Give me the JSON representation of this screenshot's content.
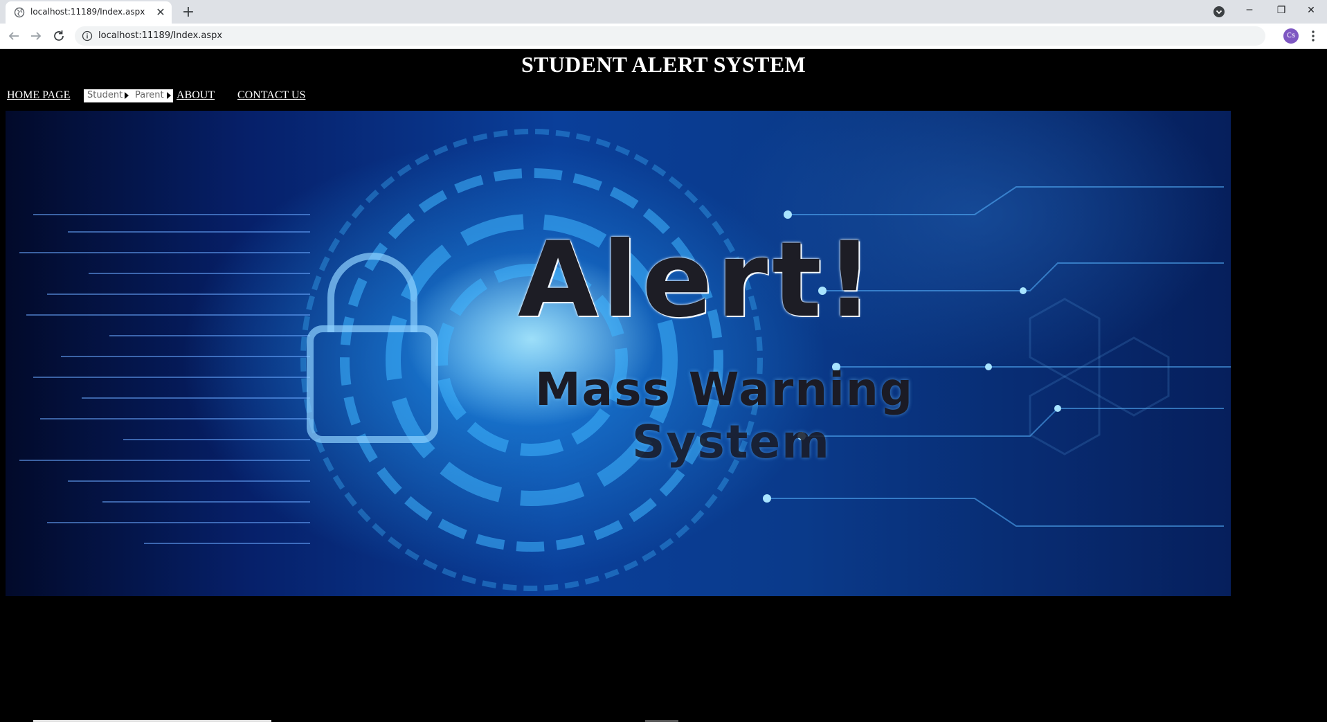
{
  "browser": {
    "tab_title": "localhost:11189/Index.aspx",
    "tab_close": "✕",
    "new_tab": "+",
    "url": "localhost:11189/Index.aspx",
    "profile_initials": "Cs",
    "window_controls": {
      "minimize": "─",
      "restore": "❐",
      "close": "✕"
    }
  },
  "page": {
    "title": "STUDENT ALERT SYSTEM",
    "nav": {
      "home": "HOME PAGE",
      "menu": [
        {
          "label": "Student"
        },
        {
          "label": "Parent"
        }
      ],
      "about": "ABOUT",
      "contact": "CONTACT US"
    },
    "hero": {
      "headline": "Alert!",
      "line1": "Mass Warning",
      "line2": "System"
    }
  },
  "colors": {
    "page_background": "#000000",
    "title_color": "#ffffff",
    "menu_background": "#ffffff",
    "menu_text": "#666666"
  },
  "icons": [
    "globe-icon",
    "back-icon",
    "forward-icon",
    "reload-icon",
    "info-icon",
    "star-icon",
    "kebab-menu-icon",
    "tab-search-icon",
    "lock-icon"
  ]
}
